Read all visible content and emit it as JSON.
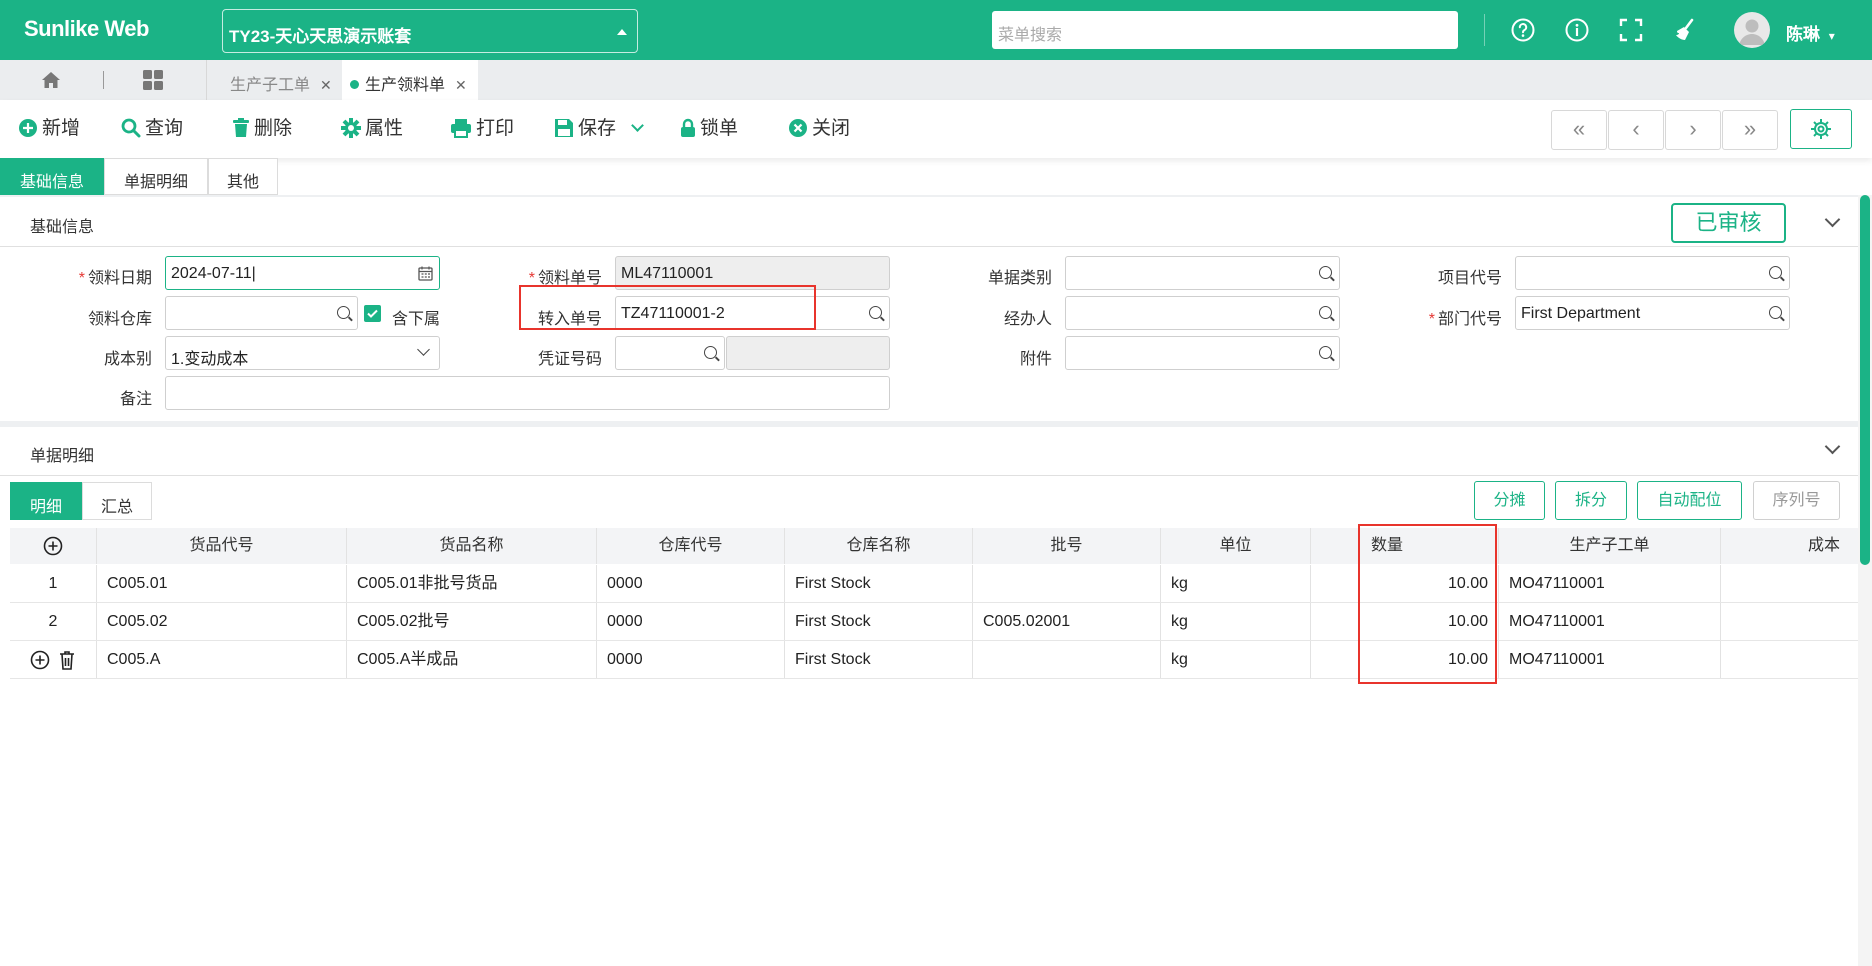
{
  "header": {
    "brand": "Sunlike Web",
    "account": "TY23-天心天思演示账套",
    "search_placeholder": "菜单搜索",
    "user": "陈琳",
    "icons": [
      "help-icon",
      "info-icon",
      "fullscreen-icon",
      "clean-icon",
      "chevron-down-icon"
    ]
  },
  "page_tabs": [
    {
      "label": "生产子工单",
      "active": false
    },
    {
      "label": "生产领料单",
      "active": true
    }
  ],
  "toolbar": {
    "new": "新增",
    "query": "查询",
    "delete": "删除",
    "properties": "属性",
    "print": "打印",
    "save": "保存",
    "lock": "锁单",
    "close": "关闭",
    "nav": [
      "«",
      "‹",
      "›",
      "»"
    ]
  },
  "section_tabs": [
    "基础信息",
    "单据明细",
    "其他"
  ],
  "basic": {
    "title": "基础信息",
    "status": "已审核",
    "fields": {
      "issue_date": {
        "label": "领料日期",
        "value": "2024-07-11",
        "required": true
      },
      "issue_no": {
        "label": "领料单号",
        "value": "ML47110001",
        "required": true
      },
      "doc_type": {
        "label": "单据类别",
        "value": ""
      },
      "project_code": {
        "label": "项目代号",
        "value": ""
      },
      "warehouse": {
        "label": "领料仓库",
        "value": ""
      },
      "include_sub": {
        "label": "含下属",
        "checked": true
      },
      "transfer_no": {
        "label": "转入单号",
        "value": "TZ47110001-2"
      },
      "handler": {
        "label": "经办人",
        "value": ""
      },
      "dept_code": {
        "label": "部门代号",
        "value": "First Department",
        "required": true
      },
      "cost_type": {
        "label": "成本别",
        "value": "1.变动成本"
      },
      "voucher_no": {
        "label": "凭证号码",
        "value": ""
      },
      "attachment": {
        "label": "附件",
        "value": ""
      },
      "remark": {
        "label": "备注",
        "value": ""
      }
    }
  },
  "detail": {
    "title": "单据明细",
    "subtabs": [
      "明细",
      "汇总"
    ],
    "actions": [
      "分摊",
      "拆分",
      "自动配位",
      "序列号"
    ],
    "columns": [
      "货品代号",
      "货品名称",
      "仓库代号",
      "仓库名称",
      "批号",
      "单位",
      "数量",
      "生产子工单",
      "成本"
    ],
    "rows": [
      {
        "idx": "1",
        "code": "C005.01",
        "name": "C005.01非批号货品",
        "wh_code": "0000",
        "wh_name": "First Stock",
        "batch": "",
        "unit": "kg",
        "qty": "10.00",
        "mo": "MO47110001",
        "cost": ""
      },
      {
        "idx": "2",
        "code": "C005.02",
        "name": "C005.02批号",
        "wh_code": "0000",
        "wh_name": "First Stock",
        "batch": "C005.02001",
        "unit": "kg",
        "qty": "10.00",
        "mo": "MO47110001",
        "cost": ""
      },
      {
        "idx": "",
        "code": "C005.A",
        "name": "C005.A半成品",
        "wh_code": "0000",
        "wh_name": "First Stock",
        "batch": "",
        "unit": "kg",
        "qty": "10.00",
        "mo": "MO47110001",
        "cost": ""
      }
    ]
  },
  "colors": {
    "accent": "#1bb386",
    "highlight": "#e8342c",
    "required": "#e53935"
  }
}
